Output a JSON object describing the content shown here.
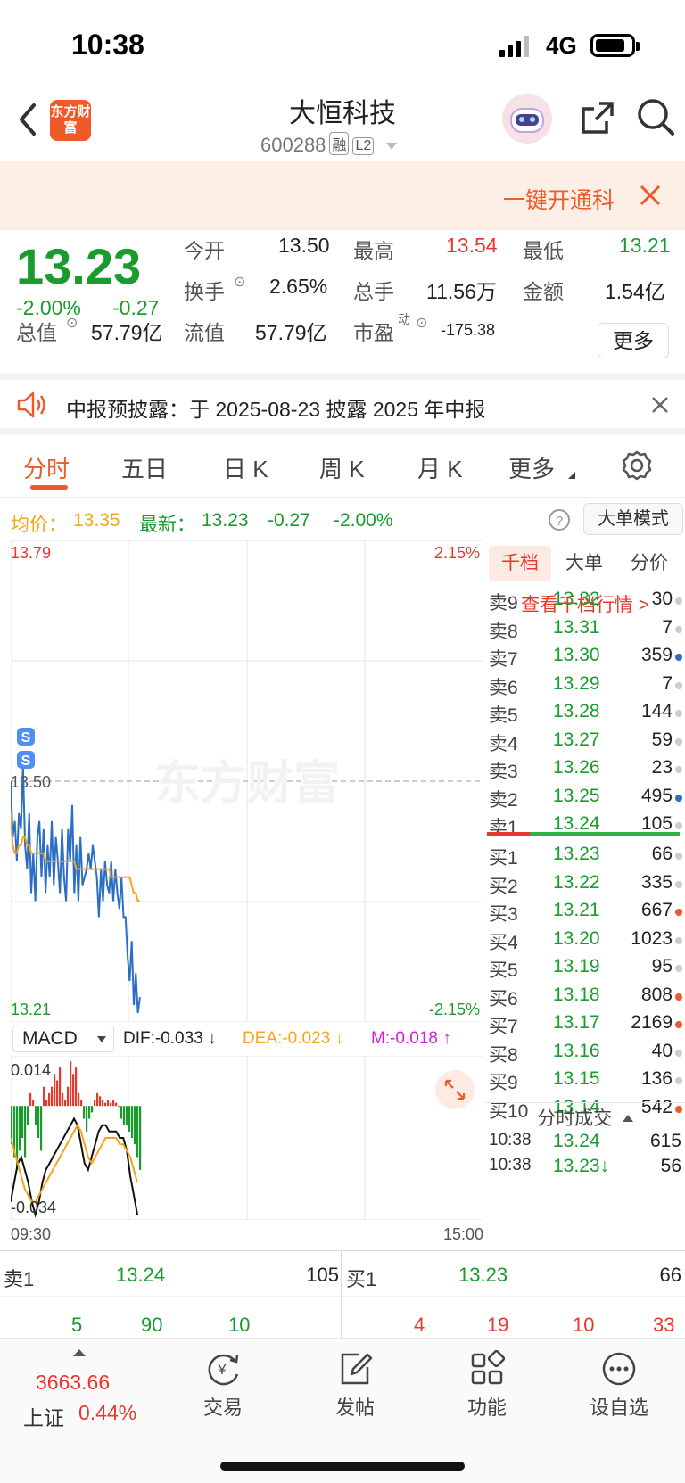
{
  "status_bar": {
    "time": "10:38",
    "network": "4G"
  },
  "header": {
    "logo_text": "东方财富",
    "stock_name": "大恒科技",
    "stock_code": "600288",
    "tags": [
      "融",
      "L2"
    ]
  },
  "banner": {
    "text": "一键开通科"
  },
  "quote": {
    "price": "13.23",
    "change_pct": "-2.00%",
    "change": "-0.27",
    "open_label": "今开",
    "open": "13.50",
    "high_label": "最高",
    "high": "13.54",
    "low_label": "最低",
    "low": "13.21",
    "turnover_label": "换手",
    "turnover": "2.65%",
    "volume_label": "总手",
    "volume": "11.56万",
    "amount_label": "金额",
    "amount": "1.54亿",
    "mcap_label": "总值",
    "mcap": "57.79亿",
    "float_label": "流值",
    "float_mcap": "57.79亿",
    "pe_label": "市盈",
    "pe_sup": "动",
    "pe": "-175.38",
    "more_button": "更多"
  },
  "notice": {
    "text": "中报预披露：于 2025-08-23 披露 2025 年中报"
  },
  "tabs": [
    "分时",
    "五日",
    "日 K",
    "周 K",
    "月 K",
    "更多"
  ],
  "avg_bar": {
    "avg_label": "均价：",
    "avg": "13.35",
    "latest_label": "最新：",
    "latest": "13.23",
    "latest_change": "-0.27",
    "latest_pct": "-2.00%",
    "mode_button": "大单模式"
  },
  "chart_data": {
    "type": "line",
    "x": [
      "09:30",
      "15:00"
    ],
    "ylim": [
      13.21,
      13.79
    ],
    "y_ref": "13.50",
    "y_top_label": "13.79",
    "y_bottom_label": "13.21",
    "pct_top": "2.15%",
    "pct_bottom": "-2.15%",
    "watermark": "东方财富",
    "series": [
      {
        "color": "#2a6ec6",
        "values": [
          13.5,
          13.43,
          13.45,
          13.4,
          13.46,
          13.44,
          13.52,
          13.42,
          13.39,
          13.46,
          13.36,
          13.41,
          13.35,
          13.43,
          13.45,
          13.38,
          13.44,
          13.36,
          13.42,
          13.38,
          13.45,
          13.37,
          13.43,
          13.4,
          13.36,
          13.44,
          13.38,
          13.35,
          13.44,
          13.4,
          13.47,
          13.36,
          13.42,
          13.35,
          13.43,
          13.37,
          13.38,
          13.39,
          13.41,
          13.39,
          13.42,
          13.4,
          13.38,
          13.33,
          13.39,
          13.35,
          13.4,
          13.37,
          13.36,
          13.4,
          13.35,
          13.39,
          13.36,
          13.34,
          13.38,
          13.33,
          13.33,
          13.28,
          13.25,
          13.3,
          13.22,
          13.26,
          13.21,
          13.23
        ]
      },
      {
        "color": "#f4a51c",
        "values": [
          13.46,
          13.42,
          13.41,
          13.41,
          13.42,
          13.42,
          13.43,
          13.43,
          13.42,
          13.42,
          13.41,
          13.41,
          13.41,
          13.41,
          13.41,
          13.41,
          13.41,
          13.4,
          13.4,
          13.4,
          13.4,
          13.4,
          13.4,
          13.4,
          13.4,
          13.4,
          13.4,
          13.4,
          13.4,
          13.4,
          13.4,
          13.4,
          13.39,
          13.39,
          13.39,
          13.39,
          13.39,
          13.39,
          13.39,
          13.39,
          13.39,
          13.39,
          13.39,
          13.39,
          13.39,
          13.39,
          13.39,
          13.39,
          13.39,
          13.38,
          13.38,
          13.38,
          13.38,
          13.38,
          13.38,
          13.38,
          13.38,
          13.38,
          13.38,
          13.37,
          13.36,
          13.36,
          13.35,
          13.35
        ]
      }
    ],
    "markers": [
      "S",
      "S"
    ]
  },
  "macd": {
    "selector": "MACD",
    "dif": "DIF:-0.033 ↓",
    "dea": "DEA:-0.023 ↓",
    "m": "M:-0.018 ↑",
    "top_label": "0.014",
    "bottom_label": "-0.034",
    "ylim": [
      -0.034,
      0.014
    ],
    "histogram": [
      -0.012,
      -0.016,
      -0.02,
      -0.014,
      -0.01,
      -0.016,
      -0.006,
      0.004,
      0.002,
      -0.006,
      -0.01,
      -0.014,
      0.006,
      0.002,
      0.004,
      0.006,
      0.01,
      0.008,
      0.012,
      0.004,
      0.002,
      0.006,
      0.014,
      0.01,
      0.012,
      0.004,
      0.002,
      -0.004,
      -0.008,
      -0.004,
      -0.002,
      0.002,
      0.004,
      0.003,
      0.002,
      0.001,
      0.002,
      0.001,
      0.002,
      0.001,
      0.0,
      -0.004,
      -0.006,
      -0.006,
      -0.008,
      -0.01,
      -0.012,
      -0.016,
      -0.02
    ],
    "dif_values": [
      -0.03,
      -0.024,
      -0.018,
      -0.016,
      -0.02,
      -0.024,
      -0.03,
      -0.034,
      -0.03,
      -0.024,
      -0.02,
      -0.018,
      -0.016,
      -0.014,
      -0.012,
      -0.01,
      -0.008,
      -0.006,
      -0.004,
      -0.006,
      -0.012,
      -0.018,
      -0.02,
      -0.016,
      -0.012,
      -0.008,
      -0.006,
      -0.006,
      -0.008,
      -0.008,
      -0.008,
      -0.01,
      -0.01,
      -0.014,
      -0.022,
      -0.028,
      -0.034
    ],
    "dea_values": [
      -0.01,
      -0.014,
      -0.018,
      -0.022,
      -0.026,
      -0.028,
      -0.03,
      -0.03,
      -0.028,
      -0.026,
      -0.024,
      -0.022,
      -0.02,
      -0.018,
      -0.016,
      -0.014,
      -0.012,
      -0.01,
      -0.008,
      -0.006,
      -0.008,
      -0.012,
      -0.016,
      -0.018,
      -0.016,
      -0.014,
      -0.012,
      -0.01,
      -0.01,
      -0.01,
      -0.01,
      -0.012,
      -0.012,
      -0.014,
      -0.016,
      -0.02,
      -0.024
    ]
  },
  "time_axis": {
    "start": "09:30",
    "end": "15:00"
  },
  "book": {
    "tabs": [
      "千档",
      "大单",
      "分价"
    ],
    "link": "查看千档行情 >",
    "sells": [
      {
        "label": "卖9",
        "price": "13.32",
        "vol": "30",
        "dot": "#cccccc"
      },
      {
        "label": "卖8",
        "price": "13.31",
        "vol": "7",
        "dot": "#cccccc"
      },
      {
        "label": "卖7",
        "price": "13.30",
        "vol": "359",
        "dot": "#2a6ec6"
      },
      {
        "label": "卖6",
        "price": "13.29",
        "vol": "7",
        "dot": "#cccccc"
      },
      {
        "label": "卖5",
        "price": "13.28",
        "vol": "144",
        "dot": "#cccccc"
      },
      {
        "label": "卖4",
        "price": "13.27",
        "vol": "59",
        "dot": "#cccccc"
      },
      {
        "label": "卖3",
        "price": "13.26",
        "vol": "23",
        "dot": "#cccccc"
      },
      {
        "label": "卖2",
        "price": "13.25",
        "vol": "495",
        "dot": "#2a6ec6"
      },
      {
        "label": "卖1",
        "price": "13.24",
        "vol": "105",
        "dot": "#cccccc"
      }
    ],
    "buys": [
      {
        "label": "买1",
        "price": "13.23",
        "vol": "66",
        "dot": "#cccccc"
      },
      {
        "label": "买2",
        "price": "13.22",
        "vol": "335",
        "dot": "#cccccc"
      },
      {
        "label": "买3",
        "price": "13.21",
        "vol": "667",
        "dot": "#f05a28"
      },
      {
        "label": "买4",
        "price": "13.20",
        "vol": "1023",
        "dot": "#cccccc"
      },
      {
        "label": "买5",
        "price": "13.19",
        "vol": "95",
        "dot": "#cccccc"
      },
      {
        "label": "买6",
        "price": "13.18",
        "vol": "808",
        "dot": "#f05a28"
      },
      {
        "label": "买7",
        "price": "13.17",
        "vol": "2169",
        "dot": "#f05a28"
      },
      {
        "label": "买8",
        "price": "13.16",
        "vol": "40",
        "dot": "#cccccc"
      },
      {
        "label": "买9",
        "price": "13.15",
        "vol": "136",
        "dot": "#cccccc"
      },
      {
        "label": "买10",
        "price": "13.14",
        "vol": "542",
        "dot": "#f05a28"
      }
    ],
    "ticks_title": "分时成交",
    "ticks": [
      {
        "time": "10:38",
        "price": "13.24",
        "vol": "615"
      },
      {
        "time": "10:38",
        "price": "13.23↓",
        "vol": "56"
      }
    ]
  },
  "bottom_quotes": {
    "sell_label": "卖1",
    "sell_price": "13.24",
    "sell_vol": "105",
    "buy_label": "买1",
    "buy_price": "13.23",
    "buy_vol": "66",
    "sell_queue": [
      "5",
      "90",
      "10"
    ],
    "buy_queue": [
      "4",
      "19",
      "10",
      "33"
    ]
  },
  "nav": {
    "index_value": "3663.66",
    "index_name": "上证",
    "index_pct": "0.44%",
    "items": [
      "交易",
      "发帖",
      "功能",
      "设自选"
    ]
  }
}
